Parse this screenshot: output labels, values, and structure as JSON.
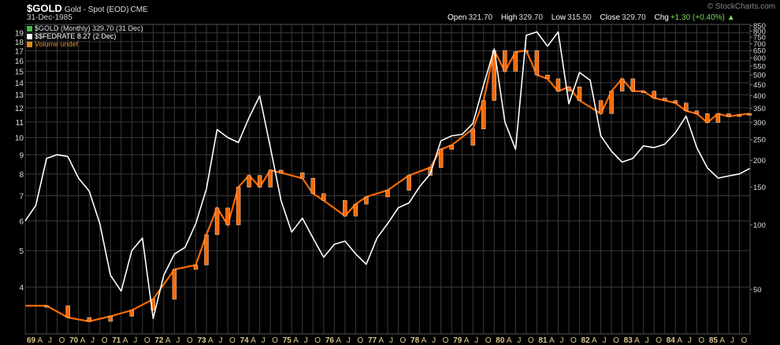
{
  "header": {
    "ticker": "$GOLD",
    "description": "Gold - Spot (EOD)",
    "exchange": "CME",
    "watermark": "© StockCharts.com",
    "date": "31-Dec-1985",
    "ohlc": {
      "open_label": "Open",
      "open": "321.70",
      "high_label": "High",
      "high": "329.70",
      "low_label": "Low",
      "low": "315.50",
      "close_label": "Close",
      "close": "329.70",
      "chg_label": "Chg",
      "chg": "+1.30 (+0.40%)"
    }
  },
  "legend": [
    {
      "label": "$GOLD (Monthly) 329.70 (31 Dec)",
      "color": "#45b94a",
      "text_color": "#dddddd",
      "icon": "candle-icon"
    },
    {
      "label": "$$FEDRATE 8.27 (2 Dec)",
      "color": "#ffffff",
      "text_color": "#ffffff",
      "icon": "line-icon"
    },
    {
      "label": "Volume undef",
      "color": "#e08a1e",
      "text_color": "#e08a1e",
      "icon": "volume-icon"
    }
  ],
  "colors": {
    "gold_up": "#ff6a00",
    "gold_down": "#ff6a00",
    "fedrate_line": "#ffffff",
    "grid": "#3a3a3a",
    "background": "#000000",
    "axis_text": "#d8c58a"
  },
  "chart_data": {
    "type": "line",
    "x_ticks": [
      "69",
      "A",
      "J",
      "O",
      "70",
      "A",
      "J",
      "O",
      "71",
      "A",
      "J",
      "O",
      "72",
      "A",
      "J",
      "O",
      "73",
      "A",
      "J",
      "O",
      "74",
      "A",
      "J",
      "O",
      "75",
      "A",
      "J",
      "O",
      "76",
      "A",
      "J",
      "O",
      "77",
      "A",
      "J",
      "O",
      "78",
      "A",
      "J",
      "O",
      "79",
      "A",
      "J",
      "O",
      "80",
      "A",
      "J",
      "O",
      "81",
      "A",
      "J",
      "O",
      "82",
      "A",
      "J",
      "O",
      "83",
      "A",
      "J",
      "O",
      "84",
      "A",
      "J",
      "O",
      "85",
      "A",
      "J",
      "O"
    ],
    "x_range": [
      1969.0,
      1986.0
    ],
    "left_axis": {
      "label": "$$FEDRATE",
      "scale": "log",
      "range": [
        3.0,
        20.0
      ],
      "ticks": [
        19,
        18,
        17,
        16,
        15,
        14,
        13,
        12,
        11,
        10,
        9,
        8,
        7,
        6,
        5,
        4
      ]
    },
    "right_axis": {
      "label": "$GOLD",
      "scale": "log",
      "range": [
        31.0,
        860.0
      ],
      "ticks": [
        850,
        800,
        750,
        700,
        650,
        600,
        550,
        500,
        450,
        400,
        350,
        300,
        250,
        200,
        150,
        100,
        50
      ]
    },
    "grid": true,
    "series": [
      {
        "name": "$GOLD (Monthly)",
        "axis": "right",
        "style": "candles",
        "points": [
          [
            1969.0,
            42
          ],
          [
            1969.5,
            42
          ],
          [
            1970.0,
            37
          ],
          [
            1970.5,
            35.5
          ],
          [
            1971.0,
            37.5
          ],
          [
            1971.5,
            40
          ],
          [
            1972.0,
            45
          ],
          [
            1972.5,
            62
          ],
          [
            1973.0,
            65
          ],
          [
            1973.25,
            90
          ],
          [
            1973.5,
            120
          ],
          [
            1973.75,
            100
          ],
          [
            1974.0,
            150
          ],
          [
            1974.25,
            170
          ],
          [
            1974.5,
            150
          ],
          [
            1974.75,
            180
          ],
          [
            1975.0,
            175
          ],
          [
            1975.5,
            165
          ],
          [
            1975.75,
            140
          ],
          [
            1976.0,
            130
          ],
          [
            1976.5,
            110
          ],
          [
            1976.75,
            125
          ],
          [
            1977.0,
            135
          ],
          [
            1977.5,
            145
          ],
          [
            1978.0,
            170
          ],
          [
            1978.5,
            185
          ],
          [
            1978.75,
            225
          ],
          [
            1979.0,
            235
          ],
          [
            1979.5,
            280
          ],
          [
            1979.75,
            380
          ],
          [
            1980.0,
            650
          ],
          [
            1980.25,
            520
          ],
          [
            1980.5,
            640
          ],
          [
            1980.75,
            650
          ],
          [
            1981.0,
            500
          ],
          [
            1981.25,
            480
          ],
          [
            1981.5,
            420
          ],
          [
            1981.75,
            440
          ],
          [
            1982.0,
            380
          ],
          [
            1982.5,
            330
          ],
          [
            1982.75,
            420
          ],
          [
            1983.0,
            480
          ],
          [
            1983.25,
            420
          ],
          [
            1983.5,
            420
          ],
          [
            1983.75,
            390
          ],
          [
            1984.0,
            380
          ],
          [
            1984.25,
            370
          ],
          [
            1984.5,
            340
          ],
          [
            1984.75,
            330
          ],
          [
            1985.0,
            300
          ],
          [
            1985.25,
            330
          ],
          [
            1985.5,
            320
          ],
          [
            1985.75,
            326
          ],
          [
            1985.99,
            329.7
          ]
        ]
      },
      {
        "name": "$$FEDRATE",
        "axis": "left",
        "style": "line",
        "points": [
          [
            1969.0,
            6.0
          ],
          [
            1969.25,
            6.6
          ],
          [
            1969.5,
            8.8
          ],
          [
            1969.75,
            9.0
          ],
          [
            1970.0,
            8.9
          ],
          [
            1970.25,
            7.8
          ],
          [
            1970.5,
            7.2
          ],
          [
            1970.75,
            5.9
          ],
          [
            1971.0,
            4.3
          ],
          [
            1971.25,
            3.9
          ],
          [
            1971.5,
            5.0
          ],
          [
            1971.75,
            5.4
          ],
          [
            1972.0,
            3.3
          ],
          [
            1972.25,
            4.3
          ],
          [
            1972.5,
            4.9
          ],
          [
            1972.75,
            5.1
          ],
          [
            1973.0,
            5.9
          ],
          [
            1973.25,
            7.3
          ],
          [
            1973.5,
            10.5
          ],
          [
            1973.75,
            10.0
          ],
          [
            1974.0,
            9.7
          ],
          [
            1974.25,
            11.3
          ],
          [
            1974.5,
            12.9
          ],
          [
            1974.75,
            9.4
          ],
          [
            1975.0,
            6.8
          ],
          [
            1975.25,
            5.6
          ],
          [
            1975.5,
            6.1
          ],
          [
            1975.75,
            5.4
          ],
          [
            1976.0,
            4.8
          ],
          [
            1976.25,
            5.2
          ],
          [
            1976.5,
            5.3
          ],
          [
            1976.75,
            4.9
          ],
          [
            1977.0,
            4.6
          ],
          [
            1977.25,
            5.4
          ],
          [
            1977.5,
            5.9
          ],
          [
            1977.75,
            6.5
          ],
          [
            1978.0,
            6.7
          ],
          [
            1978.25,
            7.4
          ],
          [
            1978.5,
            8.0
          ],
          [
            1978.75,
            9.8
          ],
          [
            1979.0,
            10.1
          ],
          [
            1979.25,
            10.2
          ],
          [
            1979.5,
            10.9
          ],
          [
            1979.75,
            13.8
          ],
          [
            1980.0,
            17.2
          ],
          [
            1980.25,
            11.0
          ],
          [
            1980.5,
            9.3
          ],
          [
            1980.75,
            18.7
          ],
          [
            1981.0,
            19.1
          ],
          [
            1981.25,
            17.5
          ],
          [
            1981.5,
            19.1
          ],
          [
            1981.75,
            12.3
          ],
          [
            1982.0,
            14.9
          ],
          [
            1982.25,
            14.2
          ],
          [
            1982.5,
            10.1
          ],
          [
            1982.75,
            9.2
          ],
          [
            1983.0,
            8.6
          ],
          [
            1983.25,
            8.8
          ],
          [
            1983.5,
            9.5
          ],
          [
            1983.75,
            9.4
          ],
          [
            1984.0,
            9.6
          ],
          [
            1984.25,
            10.3
          ],
          [
            1984.5,
            11.4
          ],
          [
            1984.75,
            9.4
          ],
          [
            1985.0,
            8.3
          ],
          [
            1985.25,
            7.8
          ],
          [
            1985.5,
            7.9
          ],
          [
            1985.75,
            8.0
          ],
          [
            1985.99,
            8.27
          ]
        ]
      }
    ]
  }
}
